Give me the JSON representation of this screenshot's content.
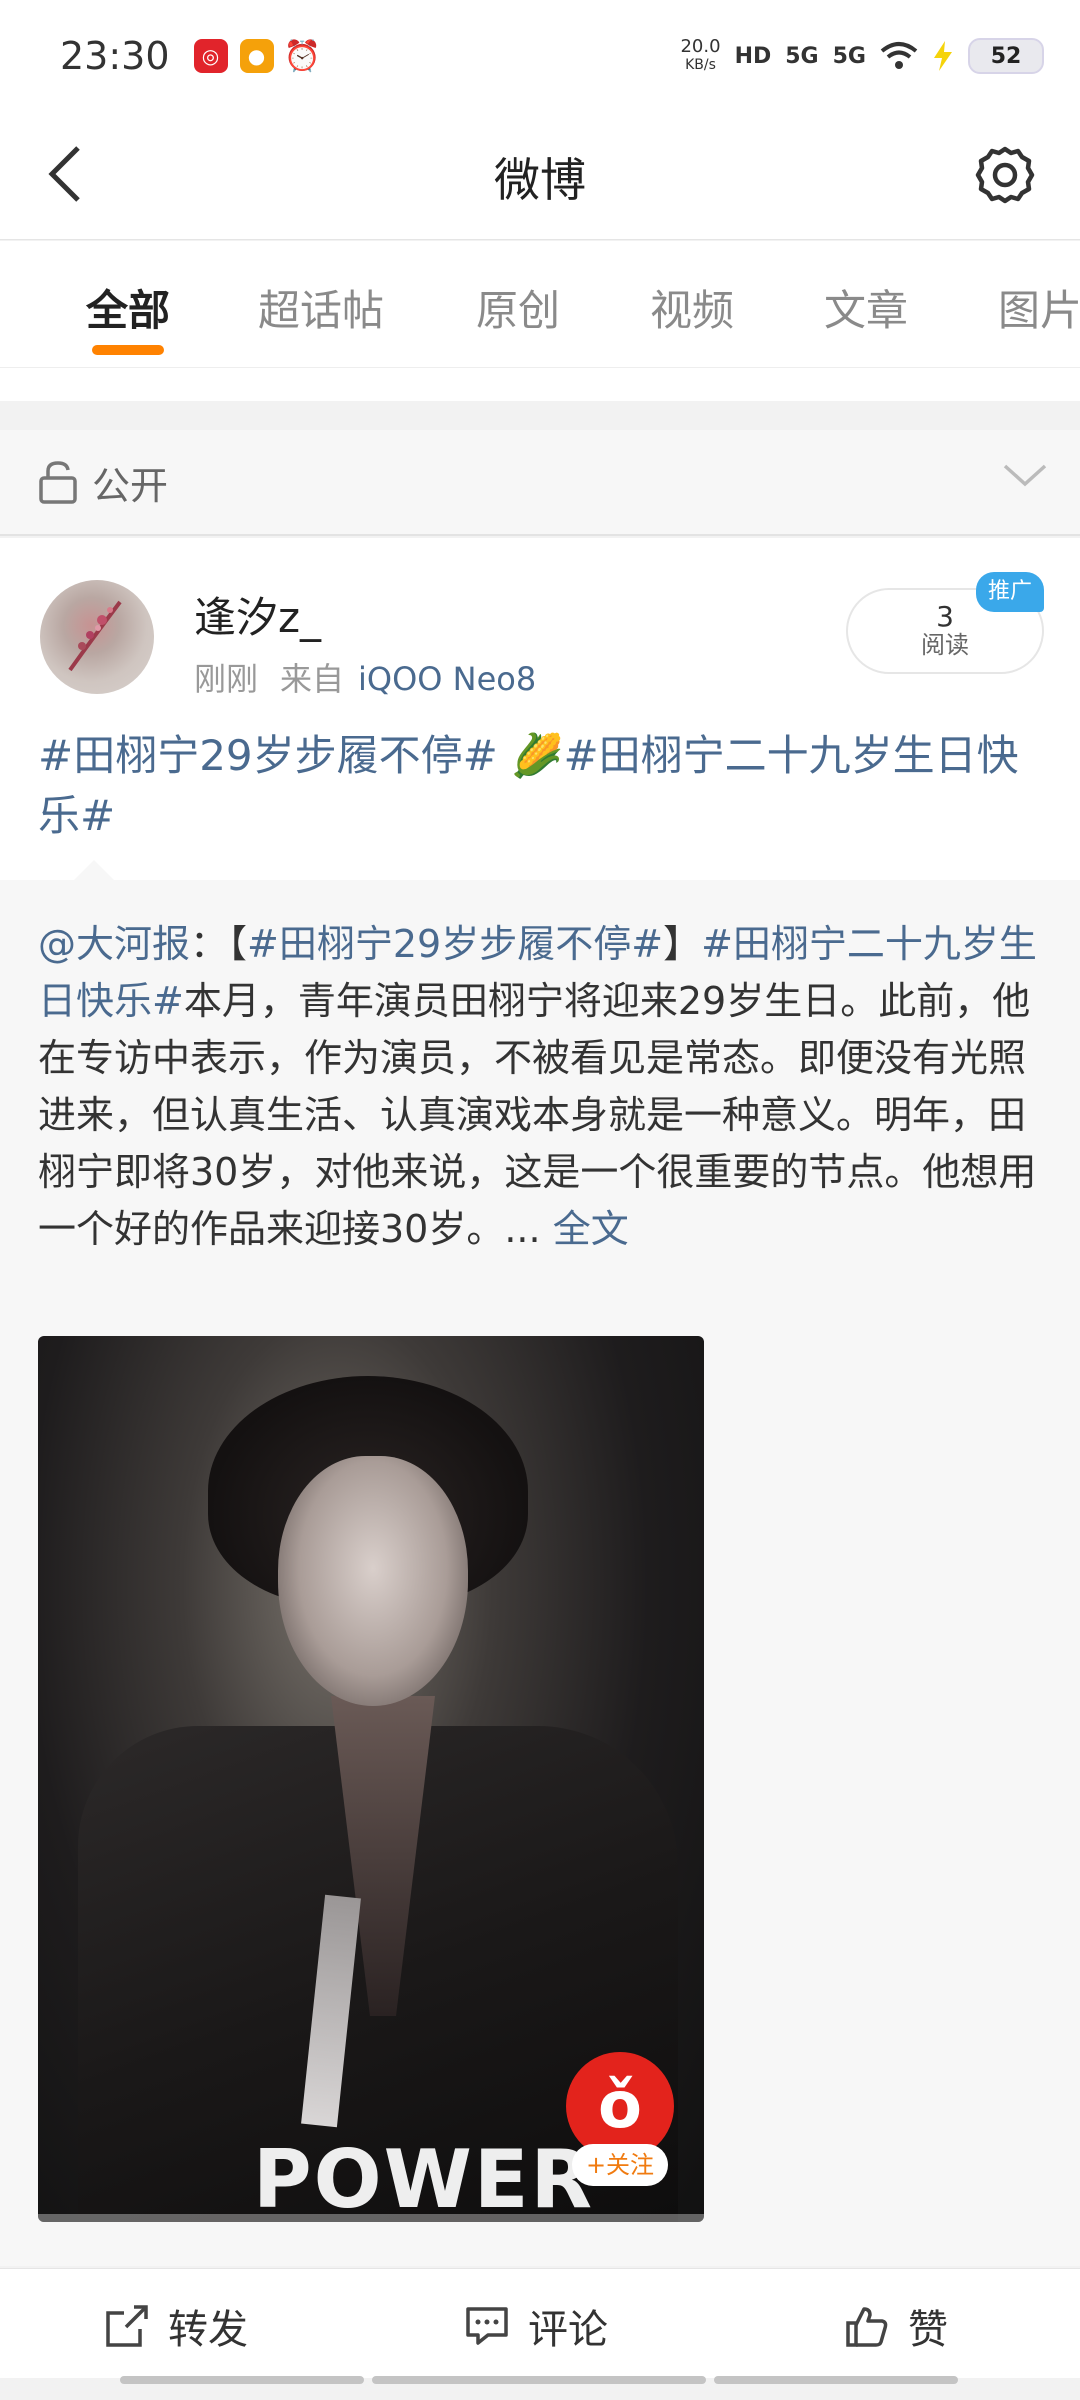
{
  "status_bar": {
    "time": "23:30",
    "speed_value": "20.0",
    "speed_unit": "KB/s",
    "hd": "HD",
    "signal_1": "5G",
    "signal_2": "5G",
    "battery": "52",
    "app_icons": [
      "netease-music-icon",
      "weibo-icon",
      "alarm-icon"
    ]
  },
  "header": {
    "title": "微博"
  },
  "tabs": [
    {
      "label": "全部",
      "active": true
    },
    {
      "label": "超话帖",
      "active": false
    },
    {
      "label": "原创",
      "active": false
    },
    {
      "label": "视频",
      "active": false
    },
    {
      "label": "文章",
      "active": false
    },
    {
      "label": "图片",
      "active": false
    }
  ],
  "visibility": {
    "label": "公开"
  },
  "post": {
    "username": "逢汐z_",
    "time": "刚刚",
    "from_label": "来自",
    "source": "iQOO Neo8",
    "read_count": "3",
    "read_label": "阅读",
    "promo_badge": "推广",
    "text_part1": "#田栩宁29岁步履不停#",
    "emoji": "🌽",
    "text_part2": "#田栩宁二十九岁生日快乐#"
  },
  "repost": {
    "mention": "@大河报",
    "sep": "：【",
    "tag1": "#田栩宁29岁步履不停#",
    "bracket_close": "】",
    "tag2": "#田栩宁二十九岁生日快乐#",
    "body": "本月，青年演员田栩宁将迎来29岁生日。此前，他在专访中表示，作为演员，不被看见是常态。即便没有光照进来，但认真生活、认真演戏本身就是一种意义。明年，田栩宁即将30岁，对他来说，这是一个很重要的节点。他想用一个好的作品来迎接30岁。...",
    "full_text_link": "全文",
    "media_caption": "POWER",
    "follow_label": "+关注"
  },
  "actions": {
    "repost": "转发",
    "comment": "评论",
    "like": "赞"
  },
  "colors": {
    "accent": "#ff8200",
    "link": "#4a6a8f",
    "promo": "#3aa8ea"
  }
}
